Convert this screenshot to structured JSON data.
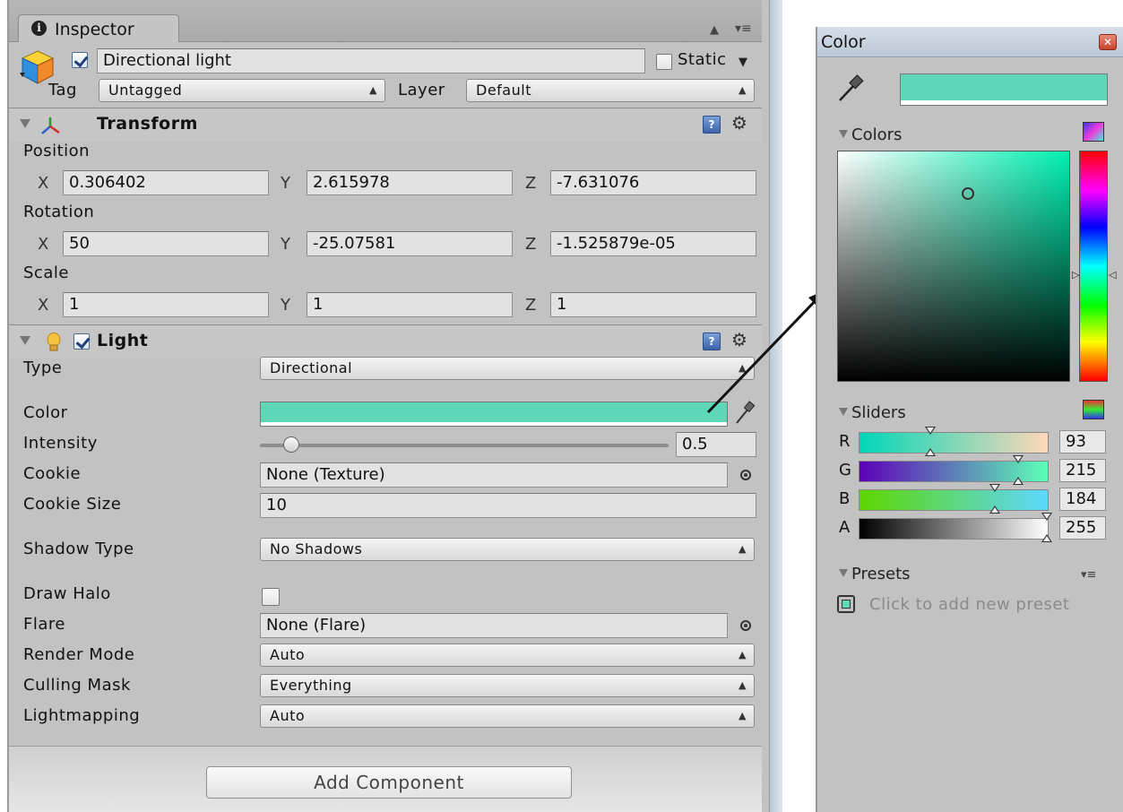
{
  "inspector": {
    "tab_label": "Inspector",
    "object_name": "Directional light",
    "static_label": "Static",
    "tag_label": "Tag",
    "tag_value": "Untagged",
    "layer_label": "Layer",
    "layer_value": "Default",
    "transform": {
      "title": "Transform",
      "position_label": "Position",
      "rotation_label": "Rotation",
      "scale_label": "Scale",
      "axis_x": "X",
      "axis_y": "Y",
      "axis_z": "Z",
      "position": {
        "x": "0.306402",
        "y": "2.615978",
        "z": "-7.631076"
      },
      "rotation": {
        "x": "50",
        "y": "-25.07581",
        "z": "-1.525879e-05"
      },
      "scale": {
        "x": "1",
        "y": "1",
        "z": "1"
      }
    },
    "light": {
      "title": "Light",
      "type_label": "Type",
      "type_value": "Directional",
      "color_label": "Color",
      "color_hex": "#5dd7b8",
      "intensity_label": "Intensity",
      "intensity_value": "0.5",
      "intensity_fraction": 0.0,
      "cookie_label": "Cookie",
      "cookie_value": "None (Texture)",
      "cookie_size_label": "Cookie Size",
      "cookie_size_value": "10",
      "shadow_type_label": "Shadow Type",
      "shadow_type_value": "No Shadows",
      "draw_halo_label": "Draw Halo",
      "flare_label": "Flare",
      "flare_value": "None (Flare)",
      "render_mode_label": "Render Mode",
      "render_mode_value": "Auto",
      "culling_mask_label": "Culling Mask",
      "culling_mask_value": "Everything",
      "lightmapping_label": "Lightmapping",
      "lightmapping_value": "Auto"
    },
    "add_component_label": "Add Component"
  },
  "color_window": {
    "title": "Color",
    "current_color_hex": "#5dd7b8",
    "colors_section": "Colors",
    "sliders_section": "Sliders",
    "sliders": [
      {
        "label": "R",
        "value": "93"
      },
      {
        "label": "G",
        "value": "215"
      },
      {
        "label": "B",
        "value": "184"
      },
      {
        "label": "A",
        "value": "255"
      }
    ],
    "presets_section": "Presets",
    "presets_hint": "Click to add new preset"
  }
}
